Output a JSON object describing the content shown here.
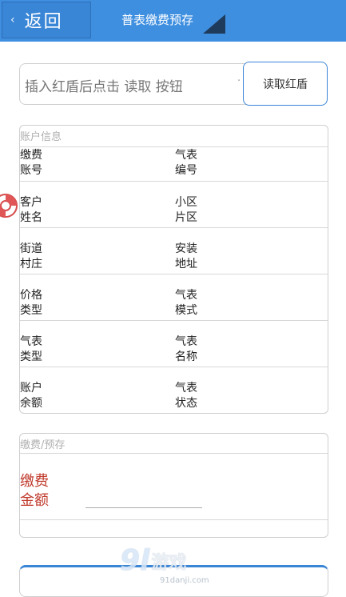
{
  "header": {
    "back_label": "返回",
    "back_icon": "chevron-left-icon",
    "title": "普表缴费预存"
  },
  "card_reader": {
    "hint": "插入红盾后点击 读取 按钮",
    "dot": "·",
    "read_button_label": "读取红盾"
  },
  "account_info": {
    "section_title": "账户信息",
    "rows": [
      {
        "left": [
          "缴费",
          "账号"
        ],
        "right": [
          "气表",
          "编号"
        ]
      },
      {
        "left": [
          "客户",
          "姓名"
        ],
        "right": [
          "小区",
          "片区"
        ]
      },
      {
        "left": [
          "街道",
          "村庄"
        ],
        "right": [
          "安装",
          "地址"
        ]
      },
      {
        "left": [
          "价格",
          "类型"
        ],
        "right": [
          "气表",
          "模式"
        ]
      },
      {
        "left": [
          "气表",
          "类型"
        ],
        "right": [
          "气表",
          "名称"
        ]
      },
      {
        "left": [
          "账户",
          "余额"
        ],
        "right": [
          "气表",
          "状态"
        ]
      }
    ]
  },
  "payment": {
    "section_title": "缴费/预存",
    "amount_label": [
      "缴费",
      "金额"
    ],
    "amount_value": ""
  },
  "watermark": {
    "logo": "9l",
    "text": "游戏",
    "sub": "91danji.com"
  },
  "colors": {
    "header_bg": "#3f8fe0",
    "accent": "#3a86d6",
    "pay_label": "#c0392b"
  }
}
